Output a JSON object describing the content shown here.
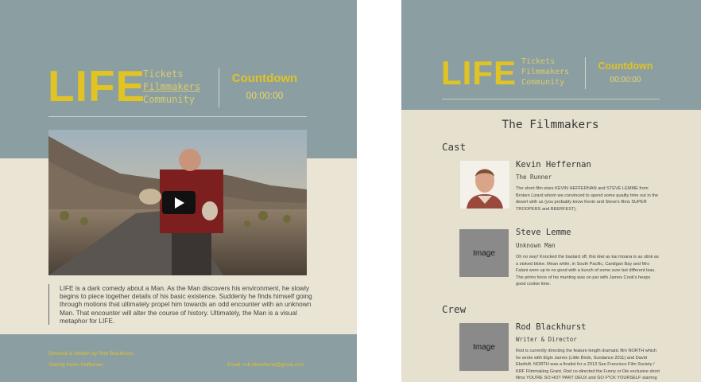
{
  "header": {
    "logo": "LIFE",
    "nav": [
      "Tickets",
      "Filmmakers",
      "Community"
    ],
    "countdown_title": "Countdown",
    "countdown_time": "00:00:00"
  },
  "home": {
    "video_play_icon": "play-icon",
    "description": "LIFE is a dark comedy about a Man.  As the Man discovers his environment, he slowly begins to piece together details of his basic existence.  Suddenly he finds himself going through motions that ultimately propel him towards an odd encounter with an unknown Man.  That encounter will alter the course of history.  Ultimately, the Man is a visual metaphor for LIFE.",
    "footer": {
      "credit_line1": "Directed & Written by Rob Blackhurst",
      "credit_line2": "Staring Kevin Heffernan",
      "email": "Email: rob.blackhurst@gmail.com"
    }
  },
  "filmmakers": {
    "title": "The Filmmakers",
    "cast_heading": "Cast",
    "crew_heading": "Crew",
    "people": [
      {
        "name": "Kevin Heffernan",
        "role": "The Runner",
        "bio": "The short film stars KEVIN HEFFERNAN and STEVE LEMME from Broken Lizard whom we convinced to spend some quality time out in the desert with us (you probably know Kevin and Steve's films SUPER TROOPERS and BEERFEST)."
      },
      {
        "name": "Steve Lemme",
        "role": "Unknown Man",
        "photo_label": "Image",
        "bio": "Oh no way! Knocked the bastard off, this kiwi as kai moana is as stink as a stoked bloke. Mean while, in South Pacific, Cardigan Bay and Mrs Falani were up to no good with a bunch of some sure but different leas. The primo force of his munting was on par with James Cook's heaps good cookie time."
      },
      {
        "name": "Rod Blackhurst",
        "role": "Writer & Director",
        "photo_label": "Image",
        "bio": "Rod is currently directing the feature length dramatic film NORTH which he wrote with Elgin James (Little Birds, Sundance 2011) and David Ebeltoft. NORTH was a finalist for a 2013 San Francisco Film Society / KRF Filmmaking Grant.  Rod co-directed the Funny or Die exclusive short films YOU'RE SO HOT PART DEUX and GO F*CK YOURSELF starring Dave"
      }
    ]
  },
  "colors": {
    "slate": "#8b9ea2",
    "paper": "#e9e4d4",
    "accent": "#e2c324"
  }
}
